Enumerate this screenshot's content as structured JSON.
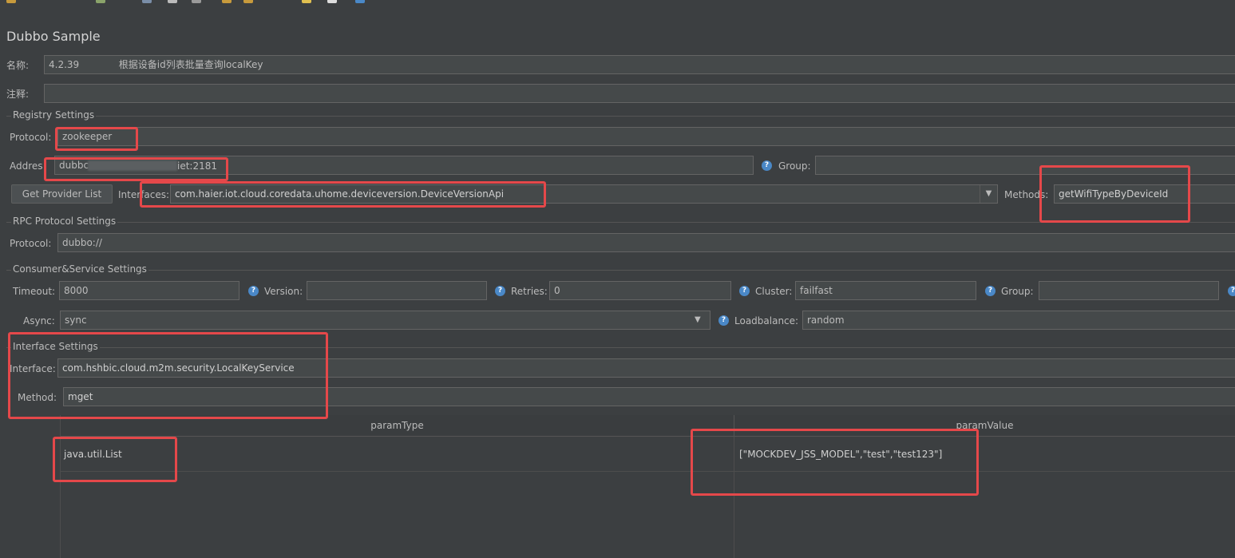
{
  "toolbar": {
    "icons": [
      "open-icon",
      "save-icon",
      "cut-icon",
      "copy-icon",
      "paste-icon",
      "expand-icon",
      "collapse-icon",
      "toggle-icon",
      "run-icon",
      "clear-icon",
      "help-icon"
    ]
  },
  "page_title": "Dubbo Sample",
  "name": {
    "label": "名称:",
    "value": "4.2.39             根据设备id列表批量查询localKey"
  },
  "comment": {
    "label": "注释:",
    "value": ""
  },
  "registry": {
    "section": "Registry Settings",
    "protocol_label": "Protocol:",
    "protocol_value": "zookeeper",
    "address_label": "Addres",
    "address_prefix": "dubbc",
    "address_suffix": "iet:2181",
    "group_label": "Group:",
    "group_value": "",
    "get_provider_button": "Get Provider List",
    "interfaces_label": "Interfaces:",
    "interfaces_value": "com.haier.iot.cloud.coredata.uhome.deviceversion.DeviceVersionApi",
    "methods_label": "Methods:",
    "methods_value": "getWifiTypeByDeviceId"
  },
  "rpc": {
    "section": "RPC Protocol Settings",
    "protocol_label": "Protocol:",
    "protocol_value": "dubbo://"
  },
  "consumer": {
    "section": "Consumer&Service Settings",
    "timeout_label": "Timeout:",
    "timeout_value": "8000",
    "version_label": "Version:",
    "version_value": "",
    "retries_label": "Retries:",
    "retries_value": "0",
    "cluster_label": "Cluster:",
    "cluster_value": "failfast",
    "group_label": "Group:",
    "group_value": "",
    "async_label": "Async:",
    "async_value": "sync",
    "loadbalance_label": "Loadbalance:",
    "loadbalance_value": "random"
  },
  "interface_settings": {
    "section": "Interface Settings",
    "interface_label": "Interface:",
    "interface_value": "com.hshbic.cloud.m2m.security.LocalKeyService",
    "method_label": "Method:",
    "method_value": "mget"
  },
  "params_table": {
    "columns": [
      "paramType",
      "paramValue"
    ],
    "rows": [
      {
        "paramType": "java.util.List",
        "paramValue": "[\"MOCKDEV_JSS_MODEL\",\"test\",\"test123\"]"
      }
    ]
  },
  "help_glyph": "?",
  "dropdown_glyph": "▼",
  "colors": {
    "highlight": "#e5484a",
    "help": "#4a88c7",
    "background": "#3c3f41"
  }
}
